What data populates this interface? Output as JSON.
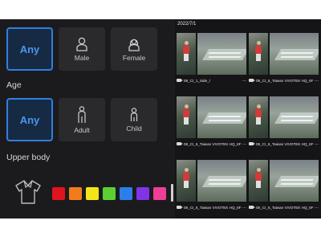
{
  "gender": {
    "options": [
      {
        "label": "Any",
        "icon": "any-text",
        "selected": true
      },
      {
        "label": "Male",
        "icon": "male-person-icon",
        "selected": false
      },
      {
        "label": "Female",
        "icon": "female-person-icon",
        "selected": false
      }
    ]
  },
  "age": {
    "heading": "Age",
    "options": [
      {
        "label": "Any",
        "selected": true
      },
      {
        "label": "Adult",
        "icon": "adult-person-icon",
        "selected": false
      },
      {
        "label": "Child",
        "icon": "child-person-icon",
        "selected": false
      }
    ]
  },
  "upper_body": {
    "heading": "Upper body",
    "icon": "shirt-icon",
    "colors": [
      "#e0141c",
      "#f07c1e",
      "#f2e61a",
      "#5ccf33",
      "#2c7ee8",
      "#8133e6",
      "#ef3e96"
    ]
  },
  "results": {
    "date": "2022/7/1",
    "cards": [
      {
        "caption": "08_CI_1_Side_l",
        "more": "..."
      },
      {
        "caption": "08_CI_6_Taiwan VIVOTEK HQ_6F",
        "more": "..."
      },
      {
        "caption": "08_CI_6_Taiwan VIVOTEK HQ_6F",
        "more": "..."
      },
      {
        "caption": "08_CI_6_Taiwan VIVOTEK HQ_6F",
        "more": "..."
      },
      {
        "caption": "08_CI_6_Taiwan VIVOTEK HQ_6F",
        "more": "..."
      },
      {
        "caption": "08_CI_6_Taiwan VIVOTEK HQ_6F",
        "more": "..."
      }
    ]
  },
  "colors": {
    "accent": "#2f7fe2",
    "panel_bg": "#1b1b1d",
    "tile_bg": "#2a2a2c"
  }
}
